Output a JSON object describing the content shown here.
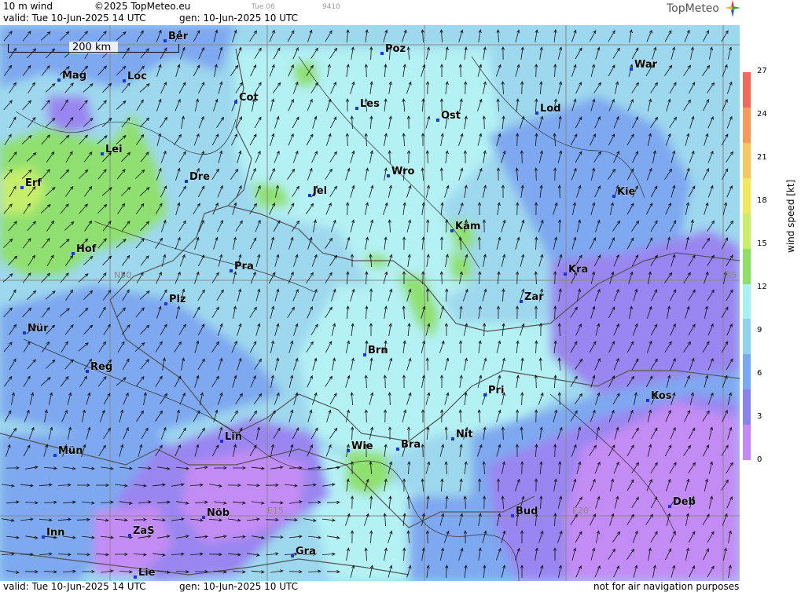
{
  "header": {
    "title": "10 m wind",
    "copyright": "©2025 TopMeteo.eu",
    "valid": "valid:  Tue  10-Jun-2025  14 UTC",
    "gen": "gen: 10-Jun-2025 10 UTC",
    "small_day": "Tue 06",
    "small_code": "9410",
    "logo": "TopMeteo"
  },
  "footer": {
    "valid": "valid:  Tue  10-Jun-2025  14 UTC",
    "gen": "gen: 10-Jun-2025 10 UTC",
    "disclaimer": "not for air navigation purposes"
  },
  "scale": {
    "label": "200 km"
  },
  "grid_labels": [
    "N50",
    "N5",
    "E15",
    "E20"
  ],
  "cities": [
    "Ber",
    "Poz",
    "War",
    "Mag",
    "Loc",
    "Cot",
    "Les",
    "Ost",
    "Lod",
    "Lei",
    "Erf",
    "Dre",
    "Wro",
    "Jel",
    "Kie",
    "Kam",
    "Hof",
    "Pra",
    "Kra",
    "Zar",
    "Plz",
    "Nür",
    "Brn",
    "Reg",
    "Pri",
    "Kos",
    "Lin",
    "Wie",
    "Bra",
    "Nit",
    "Mün",
    "Nöb",
    "Bud",
    "Deb",
    "Inn",
    "ZaS",
    "Gra",
    "Lie"
  ],
  "legend": {
    "title": "wind speed [kt]",
    "ticks": [
      "27",
      "24",
      "21",
      "18",
      "15",
      "12",
      "9",
      "6",
      "3",
      "0"
    ],
    "colors": [
      "#f06a5a",
      "#f59a5a",
      "#f7c660",
      "#f2e85a",
      "#c9ef6a",
      "#8ce068",
      "#a8f0f2",
      "#8fd3ef",
      "#78aaf0",
      "#8a82ee",
      "#c688f4"
    ]
  },
  "colors": {
    "cyan_light": "#b4f1f4",
    "cyan": "#9ed8ee",
    "blue": "#7ea8f0",
    "purple": "#9a86f0",
    "violet": "#c38cf4",
    "green": "#8fe070",
    "yellowgreen": "#c6ee6a",
    "city_marker": "#1f32d8",
    "grid": "#888888",
    "wind_arrow": "#111111"
  }
}
